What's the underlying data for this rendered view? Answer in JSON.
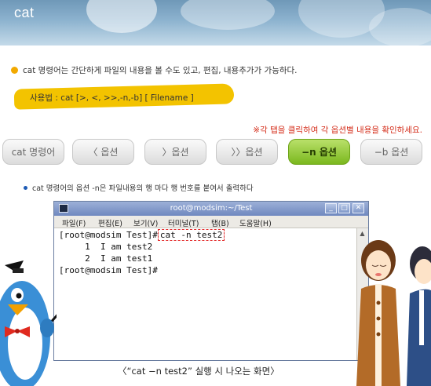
{
  "header": {
    "title": "cat"
  },
  "description": "cat 명령어는 간단하게 파일의 내용을 볼 수도 있고, 편집, 내용추가가 가능하다.",
  "usage": "사용법 : cat  [>, <, >>,-n,-b] [ Filename ]",
  "hint": "※각 탭을 클릭하여 각 옵션별 내용을 확인하세요.",
  "tabs": [
    {
      "label": "cat 명령어"
    },
    {
      "label": "〈 옵션"
    },
    {
      "label": "〉옵션"
    },
    {
      "label": "〉〉옵션"
    },
    {
      "label": "−n 옵션"
    },
    {
      "label": "−b 옵션"
    }
  ],
  "active_tab": "−n 옵션",
  "bullet": "cat 명령어의 옵션 -n은 파일내용의 행 마다 행 번호를 붙여서 출력하다",
  "terminal": {
    "title": "root@modsim:~/Test",
    "menu": [
      "파일(F)",
      "편집(E)",
      "보기(V)",
      "터미널(T)",
      "탭(B)",
      "도움말(H)"
    ],
    "lines": [
      {
        "prompt": "[root@modsim Test]#",
        "command": "cat -n test2"
      },
      {
        "text": "     1  I am test2"
      },
      {
        "text": "     2  I am test1"
      },
      {
        "prompt": "[root@modsim Test]#",
        "command": ""
      }
    ]
  },
  "caption": "〈“cat −n test2” 실행 시 나오는 화면〉",
  "colors": {
    "accent_green": "#7bb81e",
    "hint_red": "#d42d1a",
    "usage_yellow": "#f3c300",
    "header_blue": "#8db3cf"
  }
}
